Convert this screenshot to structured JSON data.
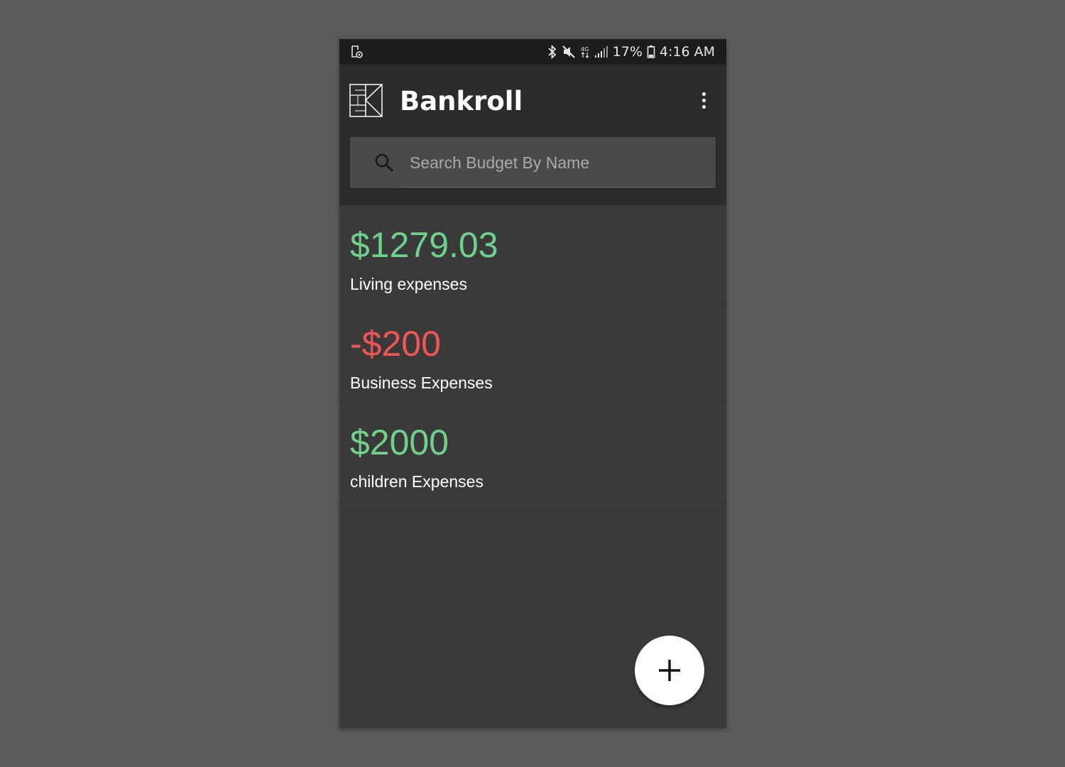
{
  "status_bar": {
    "battery_percent": "17%",
    "time": "4:16 AM",
    "icons": [
      "screenshot-notification-icon",
      "bluetooth-icon",
      "mute-icon",
      "data-icon",
      "signal-icon",
      "battery-icon"
    ]
  },
  "app_bar": {
    "title": "Bankroll",
    "logo": "bankroll-logo",
    "menu_icon": "overflow-menu-icon"
  },
  "search": {
    "placeholder": "Search Budget By Name",
    "value": "",
    "icon": "search-icon"
  },
  "budgets": [
    {
      "amount": "$1279.03",
      "name": "Living expenses",
      "status": "positive"
    },
    {
      "amount": "-$200",
      "name": "Business Expenses",
      "status": "negative"
    },
    {
      "amount": "$2000",
      "name": "children Expenses",
      "status": "positive"
    }
  ],
  "fab": {
    "icon": "add-icon"
  },
  "colors": {
    "positive": "#6fd18a",
    "negative": "#ef5656",
    "app_bar": "#2c2c2c",
    "status_bar": "#1c1c1c",
    "background": "#3a3a3a"
  }
}
